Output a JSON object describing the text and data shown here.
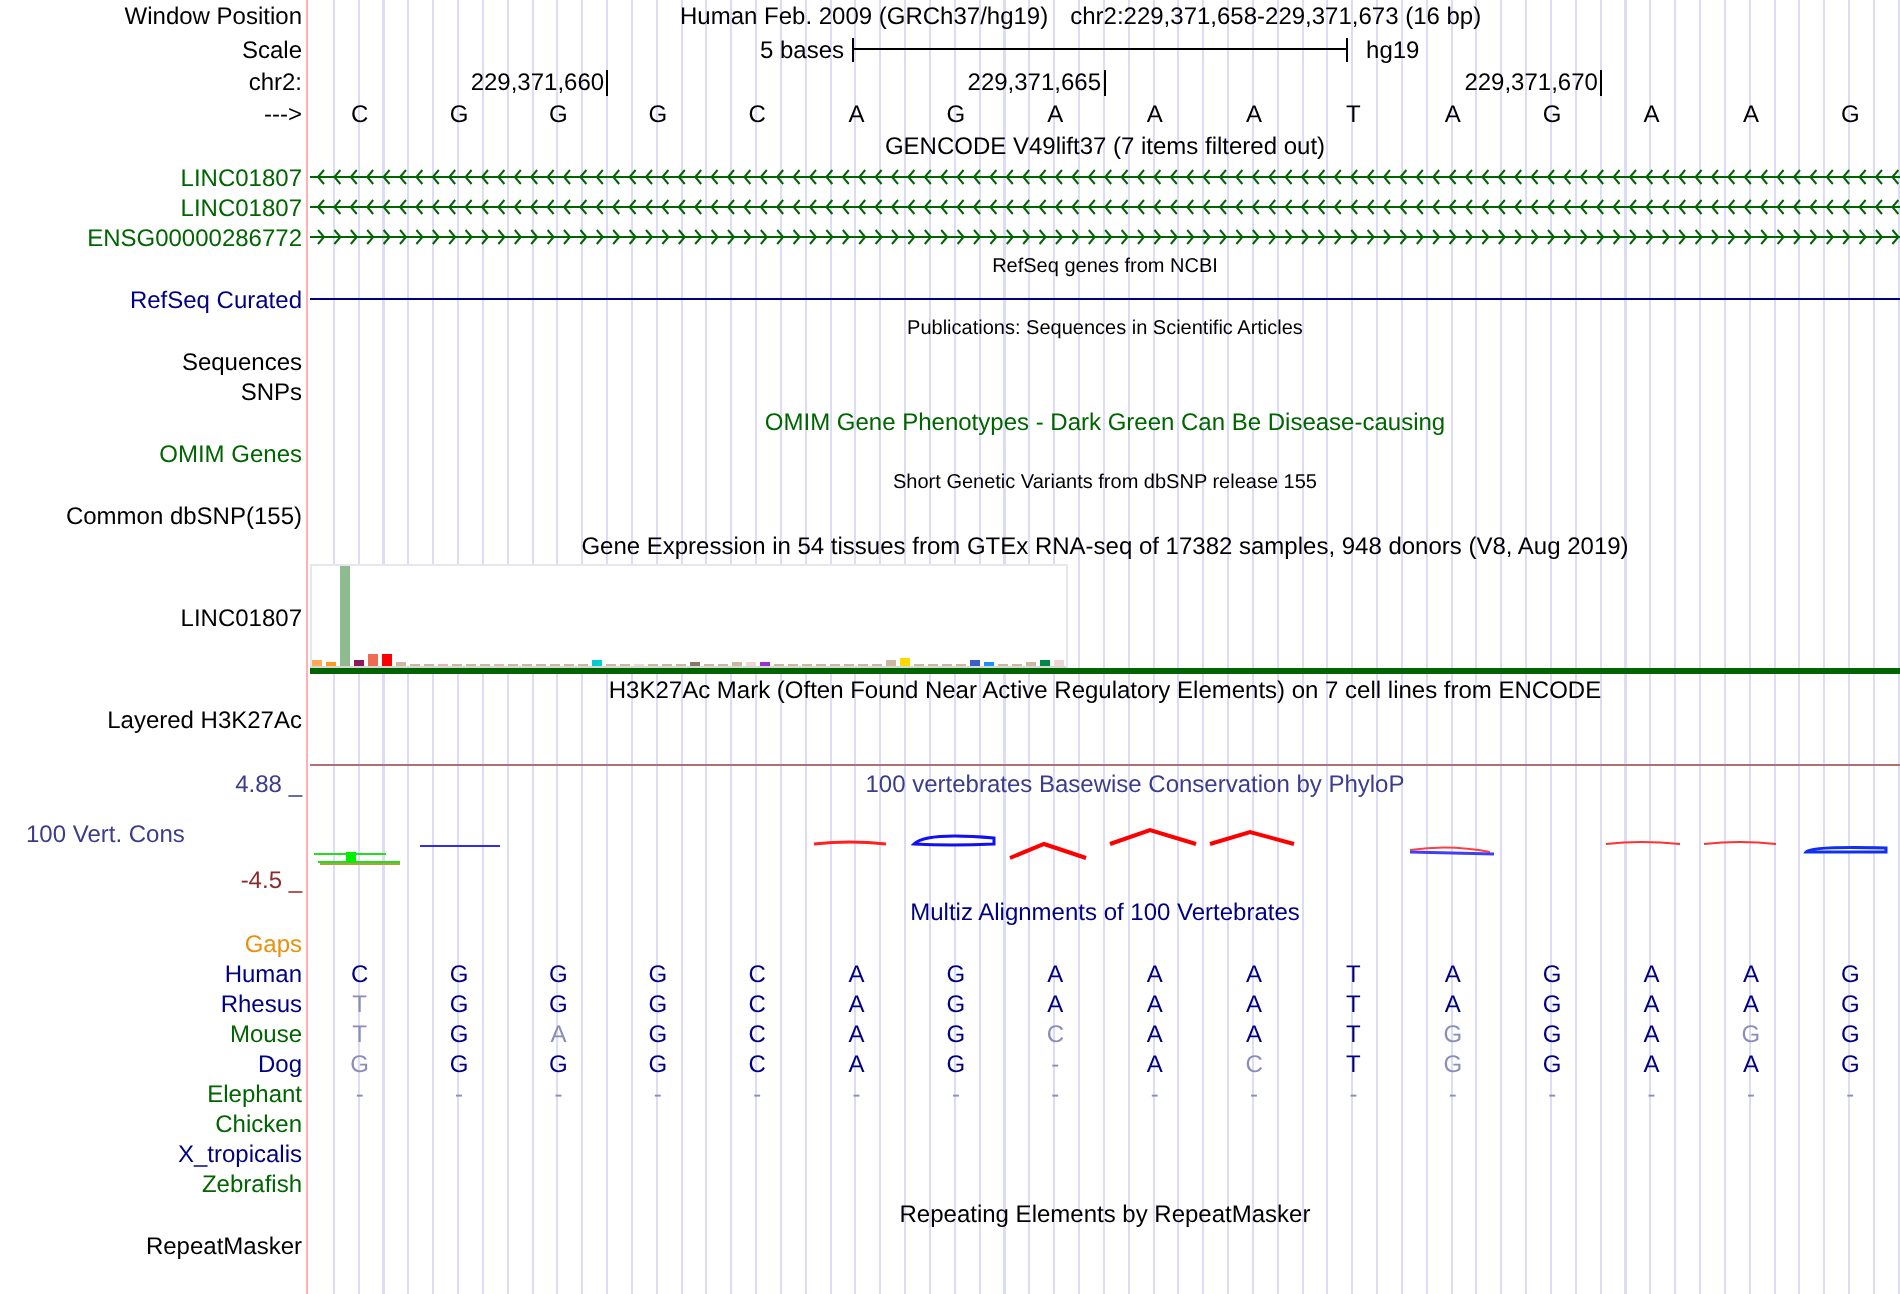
{
  "header": {
    "position_label": "Window Position",
    "assembly": "Human Feb. 2009 (GRCh37/hg19)",
    "position": "chr2:229,371,658-229,371,673 (16 bp)",
    "scale_label": "Scale",
    "scale_text": "5 bases",
    "scale_assembly": "hg19",
    "chrom_label": "chr2:",
    "ticks": [
      "229,371,660",
      "229,371,665",
      "229,371,670"
    ],
    "strand_label": "--->",
    "bases": [
      "C",
      "G",
      "G",
      "G",
      "C",
      "A",
      "G",
      "A",
      "A",
      "A",
      "T",
      "A",
      "G",
      "A",
      "A",
      "G"
    ]
  },
  "tracks": [
    {
      "kind": "title",
      "text": "GENCODE V49lift37 (7 items filtered out)",
      "color": "#000000"
    },
    {
      "kind": "gene",
      "label": "LINC01807",
      "color": "#006400",
      "arrows": true,
      "reverse": true
    },
    {
      "kind": "gene",
      "label": "LINC01807",
      "color": "#006400",
      "arrows": true,
      "reverse": true
    },
    {
      "kind": "gene",
      "label": "ENSG00000286772",
      "color": "#006400",
      "arrows": true,
      "reverse": false
    },
    {
      "kind": "subtitle",
      "text": "RefSeq genes from NCBI"
    },
    {
      "kind": "gene",
      "label": "RefSeq Curated",
      "color": "#000080",
      "arrows": false
    },
    {
      "kind": "subtitle",
      "text": "Publications: Sequences in Scientific Articles"
    },
    {
      "kind": "label",
      "label": "Sequences",
      "color": "#000000"
    },
    {
      "kind": "label",
      "label": "SNPs",
      "color": "#000000"
    },
    {
      "kind": "title",
      "text": "OMIM Gene Phenotypes - Dark Green Can Be Disease-causing",
      "color": "#006400"
    },
    {
      "kind": "label",
      "label": "OMIM Genes",
      "color": "#006400"
    },
    {
      "kind": "subtitle",
      "text": "Short Genetic Variants from dbSNP release 155"
    },
    {
      "kind": "label",
      "label": "Common dbSNP(155)",
      "color": "#000000"
    },
    {
      "kind": "title",
      "text": "Gene Expression in 54 tissues from GTEx RNA-seq of 17382 samples, 948 donors (V8, Aug 2019)",
      "color": "#000000"
    },
    {
      "kind": "expression",
      "label": "LINC01807",
      "color": "#000000"
    },
    {
      "kind": "title",
      "text": "H3K27Ac Mark (Often Found Near Active Regulatory Elements) on 7 cell lines from ENCODE",
      "color": "#000000"
    },
    {
      "kind": "label",
      "label": "Layered H3K27Ac",
      "color": "#000000"
    },
    {
      "kind": "wiggle",
      "label": "100 Vert. Cons",
      "color": "#3c3c8c",
      "max": "4.88 _",
      "min": "-4.5 _",
      "title": "100 vertebrates Basewise Conservation by PhyloP"
    },
    {
      "kind": "title",
      "text": "Multiz Alignments of 100 Vertebrates",
      "color": "#000080"
    },
    {
      "kind": "label",
      "label": "Gaps",
      "color": "#e8900c"
    },
    {
      "kind": "species",
      "label": "Human",
      "color": "#000080",
      "bases": [
        {
          "base": "C",
          "differs": false
        },
        {
          "base": "G",
          "differs": false
        },
        {
          "base": "G",
          "differs": false
        },
        {
          "base": "G",
          "differs": false
        },
        {
          "base": "C",
          "differs": false
        },
        {
          "base": "A",
          "differs": false
        },
        {
          "base": "G",
          "differs": false
        },
        {
          "base": "A",
          "differs": false
        },
        {
          "base": "A",
          "differs": false
        },
        {
          "base": "A",
          "differs": false
        },
        {
          "base": "T",
          "differs": false
        },
        {
          "base": "A",
          "differs": false
        },
        {
          "base": "G",
          "differs": false
        },
        {
          "base": "A",
          "differs": false
        },
        {
          "base": "A",
          "differs": false
        },
        {
          "base": "G",
          "differs": false
        }
      ]
    },
    {
      "kind": "species",
      "label": "Rhesus",
      "color": "#000080",
      "bases": [
        {
          "base": "T",
          "differs": true
        },
        {
          "base": "G",
          "differs": false
        },
        {
          "base": "G",
          "differs": false
        },
        {
          "base": "G",
          "differs": false
        },
        {
          "base": "C",
          "differs": false
        },
        {
          "base": "A",
          "differs": false
        },
        {
          "base": "G",
          "differs": false
        },
        {
          "base": "A",
          "differs": false
        },
        {
          "base": "A",
          "differs": false
        },
        {
          "base": "A",
          "differs": false
        },
        {
          "base": "T",
          "differs": false
        },
        {
          "base": "A",
          "differs": false
        },
        {
          "base": "G",
          "differs": false
        },
        {
          "base": "A",
          "differs": false
        },
        {
          "base": "A",
          "differs": false
        },
        {
          "base": "G",
          "differs": false
        }
      ]
    },
    {
      "kind": "species",
      "label": "Mouse",
      "color": "#006400",
      "bases": [
        {
          "base": "T",
          "differs": true
        },
        {
          "base": "G",
          "differs": false
        },
        {
          "base": "A",
          "differs": true
        },
        {
          "base": "G",
          "differs": false
        },
        {
          "base": "C",
          "differs": false
        },
        {
          "base": "A",
          "differs": false
        },
        {
          "base": "G",
          "differs": false
        },
        {
          "base": "C",
          "differs": true
        },
        {
          "base": "A",
          "differs": false
        },
        {
          "base": "A",
          "differs": false
        },
        {
          "base": "T",
          "differs": false
        },
        {
          "base": "G",
          "differs": true
        },
        {
          "base": "G",
          "differs": false
        },
        {
          "base": "A",
          "differs": false
        },
        {
          "base": "G",
          "differs": true
        },
        {
          "base": "G",
          "differs": false
        }
      ]
    },
    {
      "kind": "species",
      "label": "Dog",
      "color": "#000080",
      "bases": [
        {
          "base": "G",
          "differs": true
        },
        {
          "base": "G",
          "differs": false
        },
        {
          "base": "G",
          "differs": false
        },
        {
          "base": "G",
          "differs": false
        },
        {
          "base": "C",
          "differs": false
        },
        {
          "base": "A",
          "differs": false
        },
        {
          "base": "G",
          "differs": false
        },
        {
          "base": "-",
          "differs": true
        },
        {
          "base": "A",
          "differs": false
        },
        {
          "base": "C",
          "differs": true
        },
        {
          "base": "T",
          "differs": false
        },
        {
          "base": "G",
          "differs": true
        },
        {
          "base": "G",
          "differs": false
        },
        {
          "base": "A",
          "differs": false
        },
        {
          "base": "A",
          "differs": false
        },
        {
          "base": "G",
          "differs": false
        }
      ]
    },
    {
      "kind": "species",
      "label": "Elephant",
      "color": "#006400",
      "bases": [
        {
          "base": "-",
          "differs": true
        },
        {
          "base": "-",
          "differs": true
        },
        {
          "base": "-",
          "differs": true
        },
        {
          "base": "-",
          "differs": true
        },
        {
          "base": "-",
          "differs": true
        },
        {
          "base": "-",
          "differs": true
        },
        {
          "base": "-",
          "differs": true
        },
        {
          "base": "-",
          "differs": true
        },
        {
          "base": "-",
          "differs": true
        },
        {
          "base": "-",
          "differs": true
        },
        {
          "base": "-",
          "differs": true
        },
        {
          "base": "-",
          "differs": true
        },
        {
          "base": "-",
          "differs": true
        },
        {
          "base": "-",
          "differs": true
        },
        {
          "base": "-",
          "differs": true
        },
        {
          "base": "-",
          "differs": true
        }
      ]
    },
    {
      "kind": "label",
      "label": "Chicken",
      "color": "#006400"
    },
    {
      "kind": "label",
      "label": "X_tropicalis",
      "color": "#000080"
    },
    {
      "kind": "label",
      "label": "Zebrafish",
      "color": "#006400"
    },
    {
      "kind": "title",
      "text": "Repeating Elements by RepeatMasker",
      "color": "#000000"
    },
    {
      "kind": "label",
      "label": "RepeatMasker",
      "color": "#000000"
    }
  ]
}
